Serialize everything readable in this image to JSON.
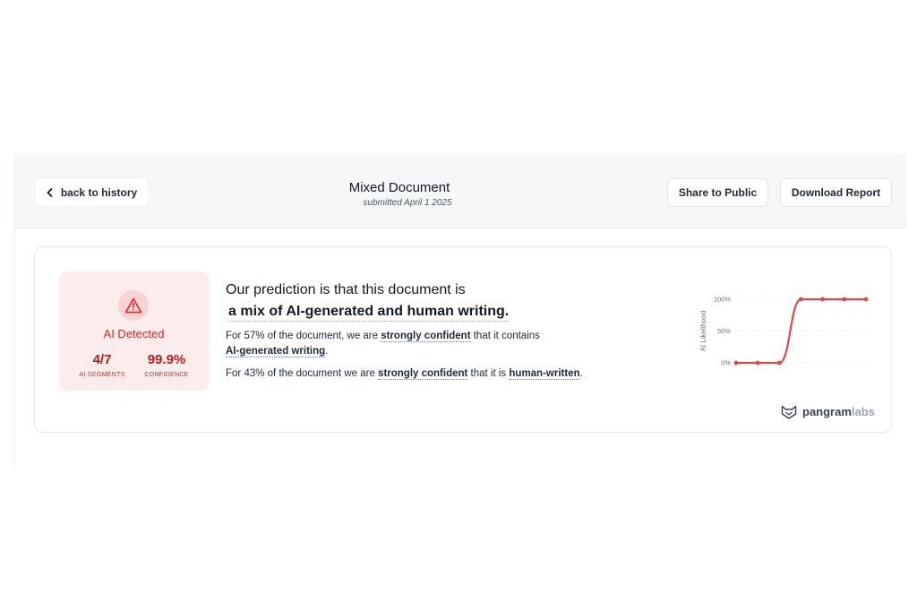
{
  "header": {
    "back_label": "back to history",
    "title": "Mixed Document",
    "subtitle": "submitted April 1 2025",
    "share_label": "Share to Public",
    "download_label": "Download Report"
  },
  "verdict": {
    "label": "AI Detected",
    "segments_value": "4/7",
    "segments_label": "AI SEGMENTS",
    "confidence_value": "99.9%",
    "confidence_label": "CONFIDENCE"
  },
  "prediction": {
    "line1": "Our prediction is that this document is",
    "line2": "a mix of AI-generated and human writing.",
    "ai_prefix": "For 57% of the document, we are ",
    "ai_strong": "strongly confident",
    "ai_mid": " that it contains ",
    "ai_target": "AI-generated writing",
    "ai_suffix": ".",
    "human_prefix": "For 43% of the document we are ",
    "human_strong": "strongly confident",
    "human_mid": " that it is ",
    "human_target": "human-written",
    "human_suffix": "."
  },
  "brand": {
    "name_a": "pangram",
    "name_b": "labs"
  },
  "colors": {
    "accent_red": "#dc2626",
    "line_red": "#e04848",
    "badge_bg": "#fdecec"
  },
  "chart_data": {
    "type": "line",
    "ylabel": "AI Likelihood",
    "ylim": [
      0,
      100
    ],
    "yticks": [
      "0%",
      "50%",
      "100%"
    ],
    "x": [
      1,
      2,
      3,
      4,
      5,
      6,
      7
    ],
    "values": [
      0,
      0,
      0,
      100,
      100,
      100,
      100
    ],
    "grid": true
  }
}
